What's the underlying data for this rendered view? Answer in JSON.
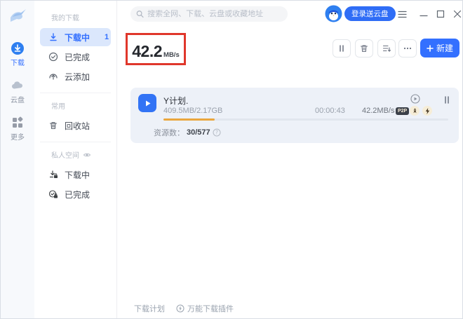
{
  "colors": {
    "accent": "#3370ff",
    "progress": "#eaa63e",
    "annotation": "#e0372b",
    "selected_bg": "#dbe7fc",
    "card_bg": "#edf1f8"
  },
  "rail": {
    "items": [
      {
        "label": "下载"
      },
      {
        "label": "云盘"
      },
      {
        "label": "更多"
      }
    ]
  },
  "sidebar": {
    "my_downloads_header": "我的下载",
    "downloading": {
      "label": "下载中",
      "count": "1"
    },
    "completed": {
      "label": "已完成"
    },
    "cloud_add": {
      "label": "云添加"
    },
    "common_header": "常用",
    "recycle": {
      "label": "回收站"
    },
    "private_header": "私人空间",
    "private_downloading": {
      "label": "下载中"
    },
    "private_completed": {
      "label": "已完成"
    }
  },
  "topbar": {
    "search_placeholder": "搜索全网、下载、云盘或收藏地址",
    "login_label": "登录送云盘"
  },
  "speed": {
    "value": "42.2",
    "unit": "MB/s"
  },
  "toolbar": {
    "new_label": "新建"
  },
  "download": {
    "title": "Y计划.",
    "size": "409.5MB/2.17GB",
    "time": "00:00:43",
    "speed": "42.2MB/s",
    "p2p_badge": "P2P",
    "progress_percent": 18,
    "resources_label": "资源数：",
    "resources_value": "30/577"
  },
  "footer": {
    "plan_label": "下载计划",
    "plugin_label": "万能下载插件"
  }
}
